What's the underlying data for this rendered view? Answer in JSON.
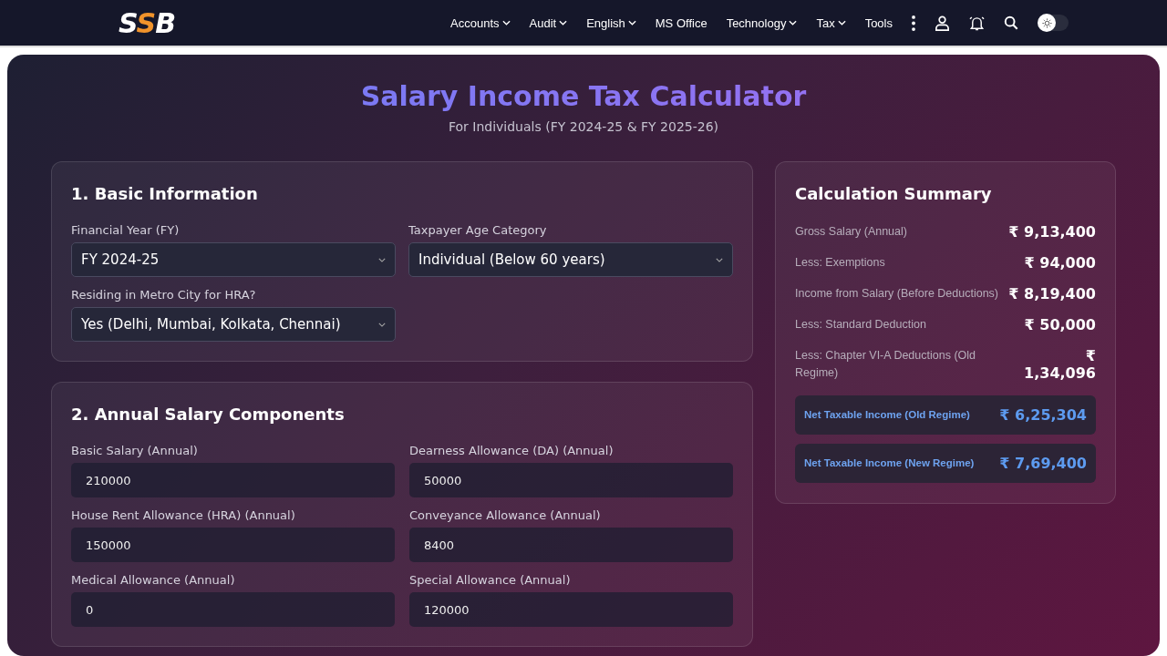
{
  "header": {
    "logo": {
      "letters": [
        "S",
        "S",
        "B"
      ]
    },
    "nav": [
      {
        "label": "Accounts",
        "dropdown": true
      },
      {
        "label": "Audit",
        "dropdown": true
      },
      {
        "label": "English",
        "dropdown": true
      },
      {
        "label": "MS Office",
        "dropdown": false
      },
      {
        "label": "Technology",
        "dropdown": true
      },
      {
        "label": "Tax",
        "dropdown": true
      },
      {
        "label": "Tools",
        "dropdown": false
      }
    ],
    "theme_toggle": {
      "on": false
    }
  },
  "page": {
    "title": "Salary Income Tax Calculator",
    "subtitle": "For Individuals (FY 2024-25 & FY 2025-26)"
  },
  "sections": [
    {
      "heading": "1. Basic Information",
      "fields": [
        {
          "kind": "select",
          "label": "Financial Year (FY)",
          "value": "FY 2024-25"
        },
        {
          "kind": "select",
          "label": "Taxpayer Age Category",
          "value": "Individual (Below 60 years)"
        },
        {
          "kind": "select",
          "label": "Residing in Metro City for HRA?",
          "value": "Yes (Delhi, Mumbai, Kolkata, Chennai)"
        }
      ]
    },
    {
      "heading": "2. Annual Salary Components",
      "fields": [
        {
          "kind": "number",
          "label": "Basic Salary (Annual)",
          "value": "210000"
        },
        {
          "kind": "number",
          "label": "Dearness Allowance (DA) (Annual)",
          "value": "50000"
        },
        {
          "kind": "number",
          "label": "House Rent Allowance (HRA) (Annual)",
          "value": "150000"
        },
        {
          "kind": "number",
          "label": "Conveyance Allowance (Annual)",
          "value": "8400"
        },
        {
          "kind": "number",
          "label": "Medical Allowance (Annual)",
          "value": "0"
        },
        {
          "kind": "number",
          "label": "Special Allowance (Annual)",
          "value": "120000"
        }
      ]
    }
  ],
  "summary": {
    "heading": "Calculation Summary",
    "rows": [
      {
        "kind": "plain",
        "label": "Gross Salary (Annual)",
        "value": "₹ 9,13,400"
      },
      {
        "kind": "plain",
        "label": "Less: Exemptions",
        "value": "₹ 94,000"
      },
      {
        "kind": "plain",
        "label": "Income from Salary (Before Deductions)",
        "value": "₹ 8,19,400"
      },
      {
        "kind": "plain",
        "label": "Less: Standard Deduction",
        "value": "₹ 50,000"
      },
      {
        "kind": "plain",
        "label": "Less: Chapter VI-A Deductions (Old Regime)",
        "value": "₹ 1,34,096"
      },
      {
        "kind": "highlight",
        "label": "Net Taxable Income (Old Regime)",
        "value": "₹ 6,25,304"
      },
      {
        "kind": "highlight",
        "label": "Net Taxable Income (New Regime)",
        "value": "₹ 7,69,400"
      }
    ]
  }
}
